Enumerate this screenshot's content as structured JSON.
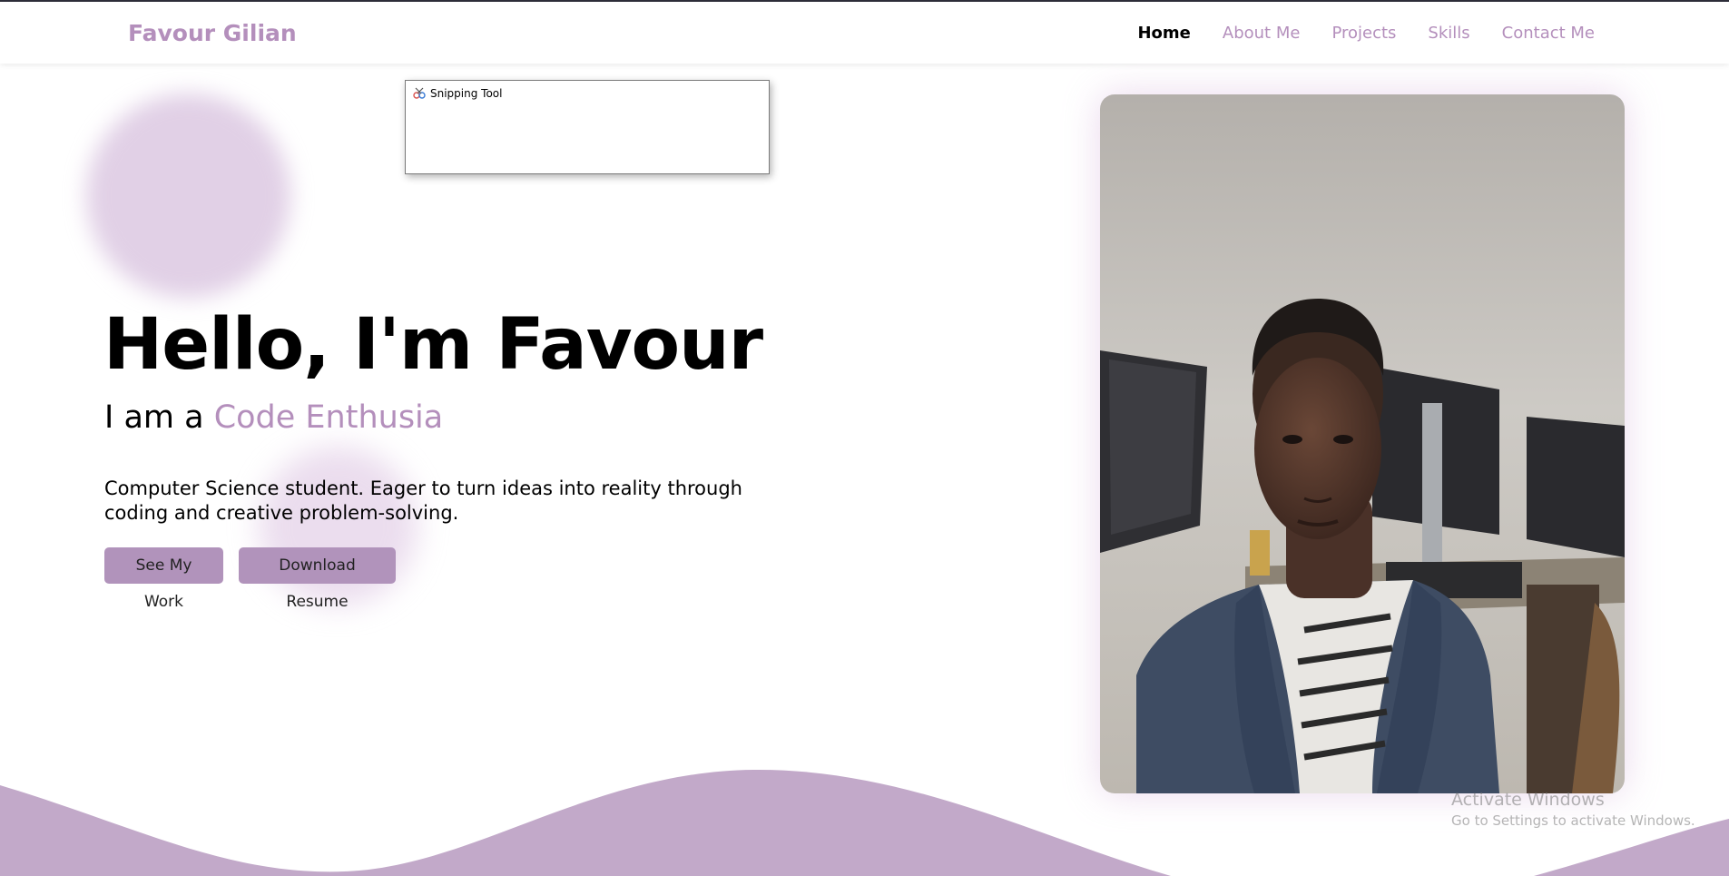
{
  "nav": {
    "brand": "Favour Gilian",
    "links": [
      "Home",
      "About Me",
      "Projects",
      "Skills",
      "Contact Me"
    ],
    "active": "Home"
  },
  "snipping_tool": {
    "title": "Snipping Tool"
  },
  "hero": {
    "title": "Hello, I'm Favour",
    "subtitle_prefix": "I am a ",
    "subtitle_accent": "Code Enthusia",
    "description": "Computer Science student. Eager to turn ideas into reality through coding and creative problem-solving.",
    "buttons": {
      "work": "See My Work",
      "resume": "Download Resume"
    }
  },
  "watermark": {
    "line1": "Activate Windows",
    "line2": "Go to Settings to activate Windows."
  },
  "colors": {
    "accent": "#b48fbc",
    "button": "#b193bb",
    "wave": "#c2a9c9",
    "text": "#000000"
  }
}
